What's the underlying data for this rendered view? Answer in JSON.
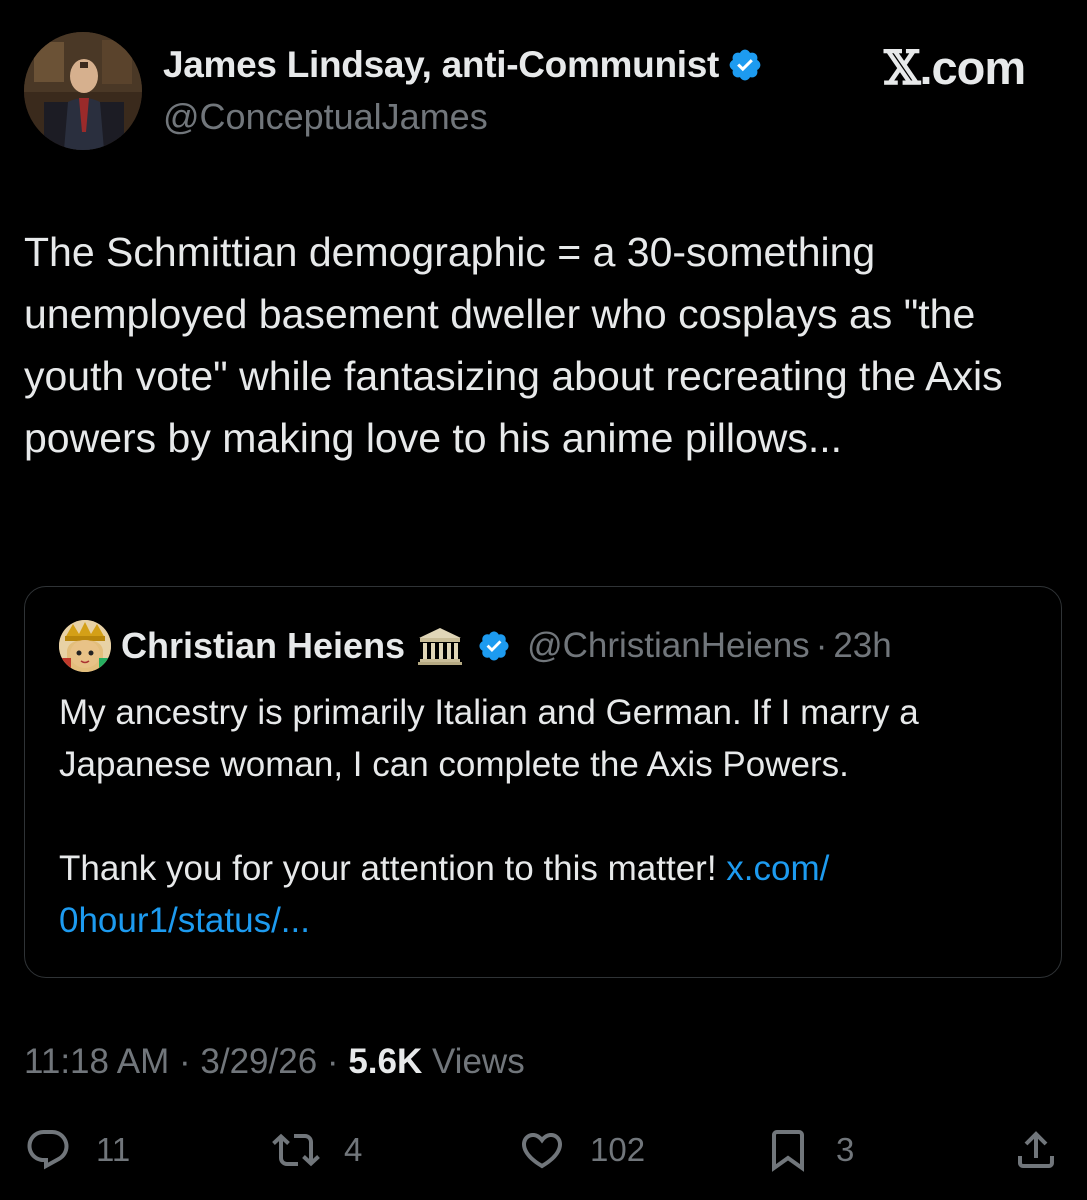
{
  "author": {
    "display_name": "James Lindsay, anti-Communist",
    "handle": "@ConceptualJames",
    "verified": true
  },
  "site_logo": {
    "mark": "𝕏",
    "suffix": ".com"
  },
  "tweet": {
    "text": "The Schmittian demographic = a 30-something unemployed basement dweller who cosplays as \"the youth vote\" while fantasizing about recreating the Axis powers by making love to his anime pillows..."
  },
  "quoted": {
    "display_name": "Christian Heiens",
    "handle": "@ChristianHeiens",
    "separator": "·",
    "time": "23h",
    "text_1": "My ancestry is primarily Italian and German. If I marry a Japanese woman, I can complete the Axis Powers.",
    "text_2": "Thank you for your attention to this matter! ",
    "link_1": "x.com/",
    "link_2": "0hour1/status/..."
  },
  "meta": {
    "time": "11:18 AM",
    "sep1": "·",
    "date": "3/29/26",
    "sep2": "·",
    "views_count": "5.6K",
    "views_label": " Views"
  },
  "actions": {
    "replies": "11",
    "reposts": "4",
    "likes": "102",
    "bookmarks": "3"
  },
  "colors": {
    "background": "#000000",
    "text": "#e7e9ea",
    "secondary": "#71767b",
    "link": "#1d9bf0",
    "verified": "#1d9bf0",
    "border": "#2f3336"
  }
}
